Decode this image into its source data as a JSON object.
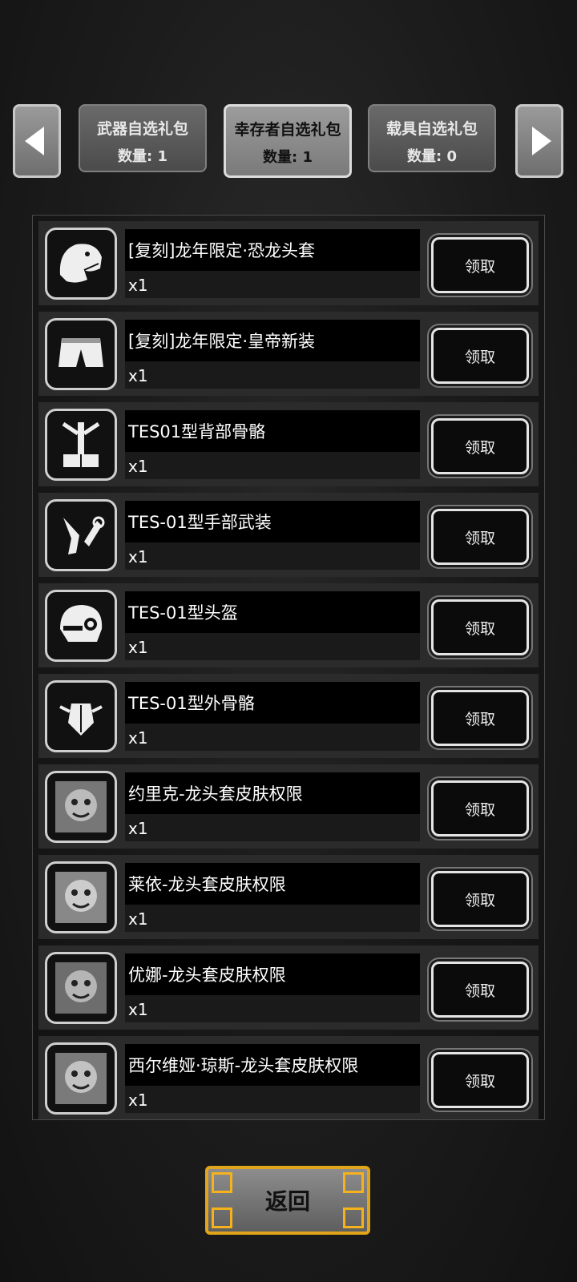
{
  "tabs": [
    {
      "name": "武器自选礼包",
      "count": "数量: 1"
    },
    {
      "name": "幸存者自选礼包",
      "count": "数量: 1"
    },
    {
      "name": "载具自选礼包",
      "count": "数量: 0"
    }
  ],
  "items": [
    {
      "name": "[复刻]龙年限定·恐龙头套",
      "qty": "x1",
      "button": "领取",
      "icon": "dinosaur-head-icon"
    },
    {
      "name": "[复刻]龙年限定·皇帝新装",
      "qty": "x1",
      "button": "领取",
      "icon": "shorts-icon"
    },
    {
      "name": "TES01型背部骨骼",
      "qty": "x1",
      "button": "领取",
      "icon": "back-exoskeleton-icon"
    },
    {
      "name": "TES-01型手部武装",
      "qty": "x1",
      "button": "领取",
      "icon": "hand-armor-icon"
    },
    {
      "name": "TES-01型头盔",
      "qty": "x1",
      "button": "领取",
      "icon": "helmet-icon"
    },
    {
      "name": "TES-01型外骨骼",
      "qty": "x1",
      "button": "领取",
      "icon": "exoskeleton-icon"
    },
    {
      "name": "约里克-龙头套皮肤权限",
      "qty": "x1",
      "button": "领取",
      "icon": "dragon-skin-portrait-icon"
    },
    {
      "name": "莱依-龙头套皮肤权限",
      "qty": "x1",
      "button": "领取",
      "icon": "dragon-skin-portrait-icon"
    },
    {
      "name": "优娜-龙头套皮肤权限",
      "qty": "x1",
      "button": "领取",
      "icon": "dragon-skin-portrait-icon"
    },
    {
      "name": "西尔维娅·琼斯-龙头套皮肤权限",
      "qty": "x1",
      "button": "领取",
      "icon": "dragon-skin-portrait-icon"
    }
  ],
  "back_label": "返回"
}
